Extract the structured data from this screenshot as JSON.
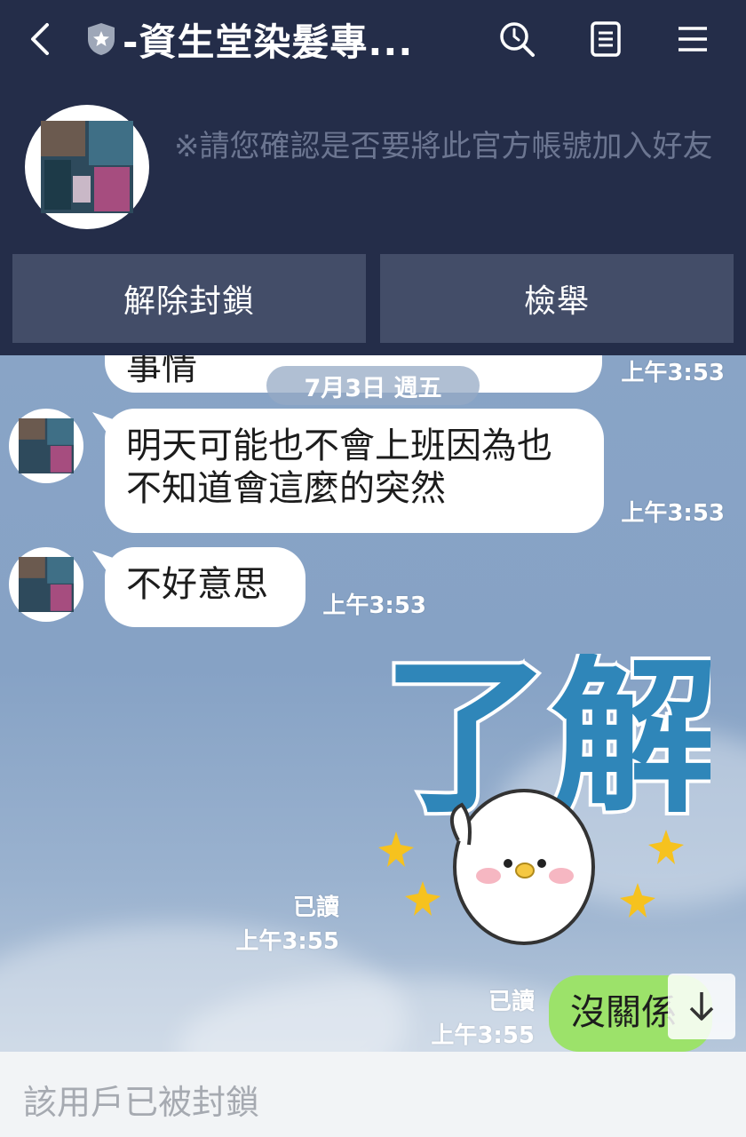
{
  "header": {
    "title": "-資生堂染髮專...",
    "notice": "※請您確認是否要將此官方帳號加入好友",
    "unblock_label": "解除封鎖",
    "report_label": "檢舉"
  },
  "chat": {
    "partial_message": "事情",
    "partial_time": "上午3:53",
    "date_label": "7月3日 週五",
    "messages": [
      {
        "text": "明天可能也不會上班因為也不知道會這麼的突然",
        "time": "上午3:53"
      },
      {
        "text": "不好意思",
        "time": "上午3:53"
      }
    ],
    "sticker": {
      "text": "了解",
      "read_label": "已讀",
      "time": "上午3:55"
    },
    "last_sent": {
      "text": "沒關係",
      "read_label": "已讀",
      "time": "上午3:55"
    }
  },
  "footer": {
    "blocked_text": "該用戶已被封鎖"
  },
  "colors": {
    "header_bg": "#242d49",
    "button_bg": "#434d68",
    "chat_bg": "#89a4c6",
    "sent_bubble": "#9ce26a",
    "sticker_text": "#2f86b9"
  },
  "icons": [
    "back-icon",
    "shield-star-icon",
    "search-icon",
    "notes-icon",
    "menu-icon",
    "arrow-down-icon"
  ]
}
